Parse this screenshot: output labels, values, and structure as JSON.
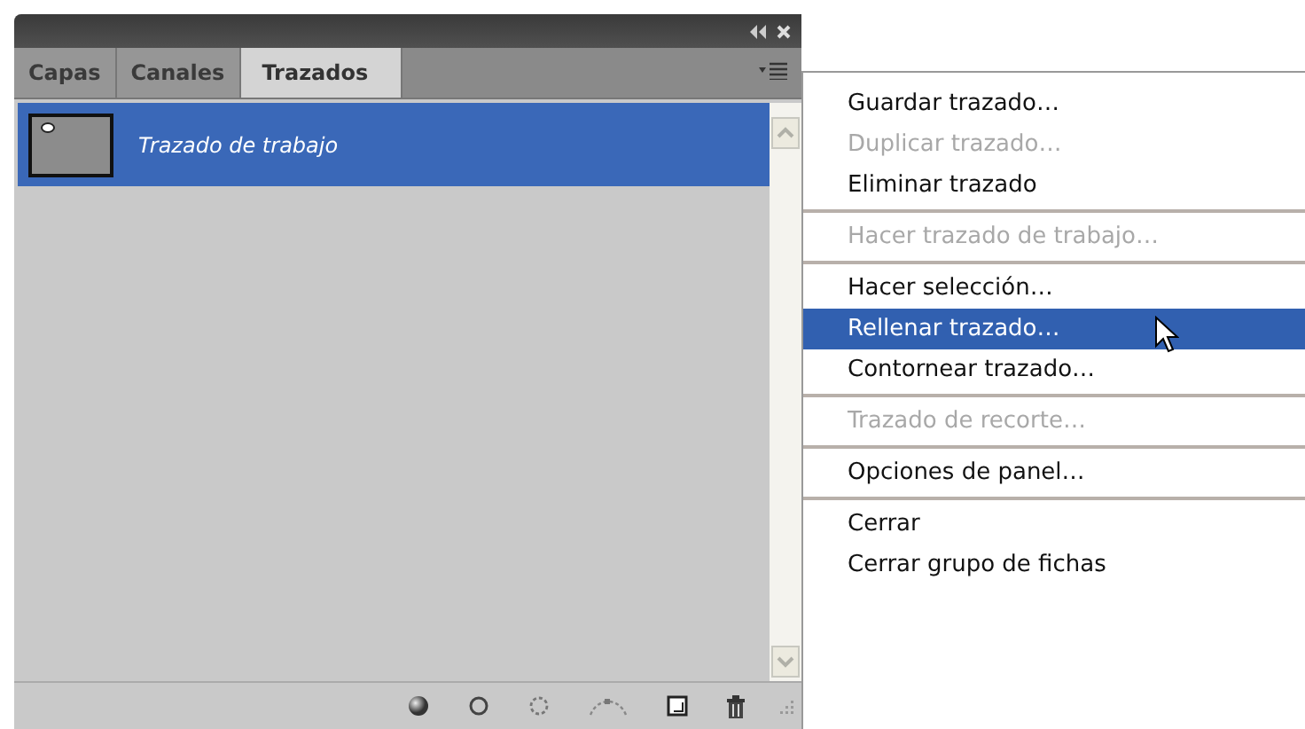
{
  "panel": {
    "tabs": [
      {
        "label": "Capas",
        "selected": false
      },
      {
        "label": "Canales",
        "selected": false
      },
      {
        "label": "Trazados",
        "selected": true
      }
    ],
    "paths": [
      {
        "name": "Trazado de trabajo",
        "selected": true
      }
    ]
  },
  "menu": {
    "items": [
      {
        "kind": "item",
        "label": "Guardar trazado…",
        "disabled": false,
        "selected": false
      },
      {
        "kind": "item",
        "label": "Duplicar trazado…",
        "disabled": true,
        "selected": false
      },
      {
        "kind": "item",
        "label": "Eliminar trazado",
        "disabled": false,
        "selected": false
      },
      {
        "kind": "separator"
      },
      {
        "kind": "item",
        "label": "Hacer trazado de trabajo…",
        "disabled": true,
        "selected": false
      },
      {
        "kind": "separator"
      },
      {
        "kind": "item",
        "label": "Hacer selección…",
        "disabled": false,
        "selected": false
      },
      {
        "kind": "item",
        "label": "Rellenar trazado…",
        "disabled": false,
        "selected": true
      },
      {
        "kind": "item",
        "label": "Contornear trazado…",
        "disabled": false,
        "selected": false
      },
      {
        "kind": "separator"
      },
      {
        "kind": "item",
        "label": "Trazado de recorte…",
        "disabled": true,
        "selected": false
      },
      {
        "kind": "separator"
      },
      {
        "kind": "item",
        "label": "Opciones de panel…",
        "disabled": false,
        "selected": false
      },
      {
        "kind": "separator"
      },
      {
        "kind": "item",
        "label": "Cerrar",
        "disabled": false,
        "selected": false
      },
      {
        "kind": "item",
        "label": "Cerrar grupo de fichas",
        "disabled": false,
        "selected": false
      }
    ]
  }
}
